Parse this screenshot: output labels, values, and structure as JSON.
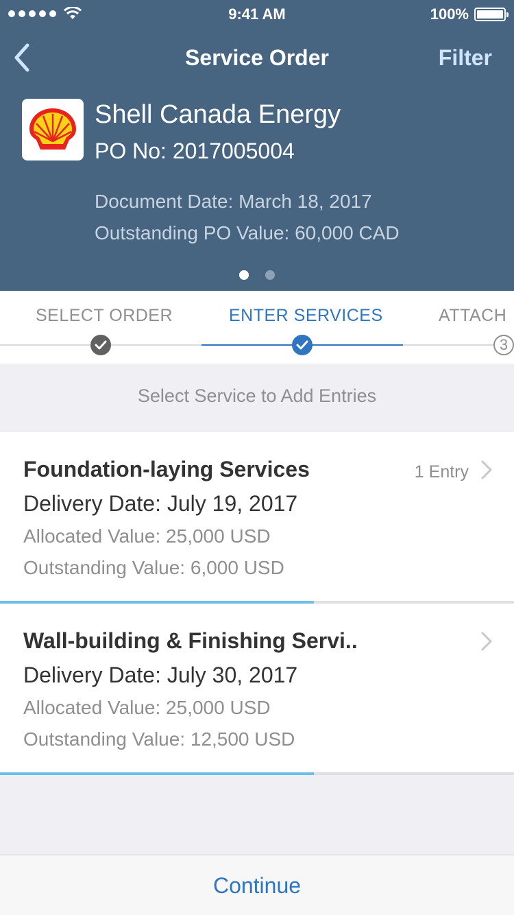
{
  "status_bar": {
    "time": "9:41 AM",
    "battery": "100%"
  },
  "nav": {
    "title": "Service Order",
    "filter_label": "Filter"
  },
  "header": {
    "company": "Shell Canada Energy",
    "po_number": "PO No: 2017005004",
    "document_date": "Document Date: March 18, 2017",
    "outstanding_po_value": "Outstanding PO Value: 60,000 CAD",
    "page_indicator": {
      "current": 1,
      "total": 2
    }
  },
  "stepper": {
    "steps": [
      {
        "label": "SELECT ORDER",
        "state": "done"
      },
      {
        "label": "ENTER SERVICES",
        "state": "current"
      },
      {
        "label": "ATTACH",
        "state": "pending",
        "number": "3"
      }
    ]
  },
  "instruction": "Select Service to Add Entries",
  "services": [
    {
      "title": "Foundation-laying Services",
      "entries": "1 Entry",
      "delivery_date": "Delivery Date: July 19, 2017",
      "allocated_value": "Allocated Value: 25,000 USD",
      "outstanding_value": "Outstanding Value: 6,000 USD",
      "progress_percent": 61
    },
    {
      "title": "Wall-building & Finishing Servi..",
      "entries": "",
      "delivery_date": "Delivery Date: July 30, 2017",
      "allocated_value": "Allocated Value: 25,000 USD",
      "outstanding_value": "Outstanding Value: 12,500 USD",
      "progress_percent": 61
    }
  ],
  "footer": {
    "continue_label": "Continue"
  },
  "colors": {
    "header_bg": "#476581",
    "accent": "#2f75c1",
    "progress": "#6ec0ea"
  },
  "icons": {
    "back": "chevron-left-icon",
    "logo": "shell-logo",
    "step_done": "checkmark-icon",
    "row_chevron": "chevron-right-icon"
  }
}
